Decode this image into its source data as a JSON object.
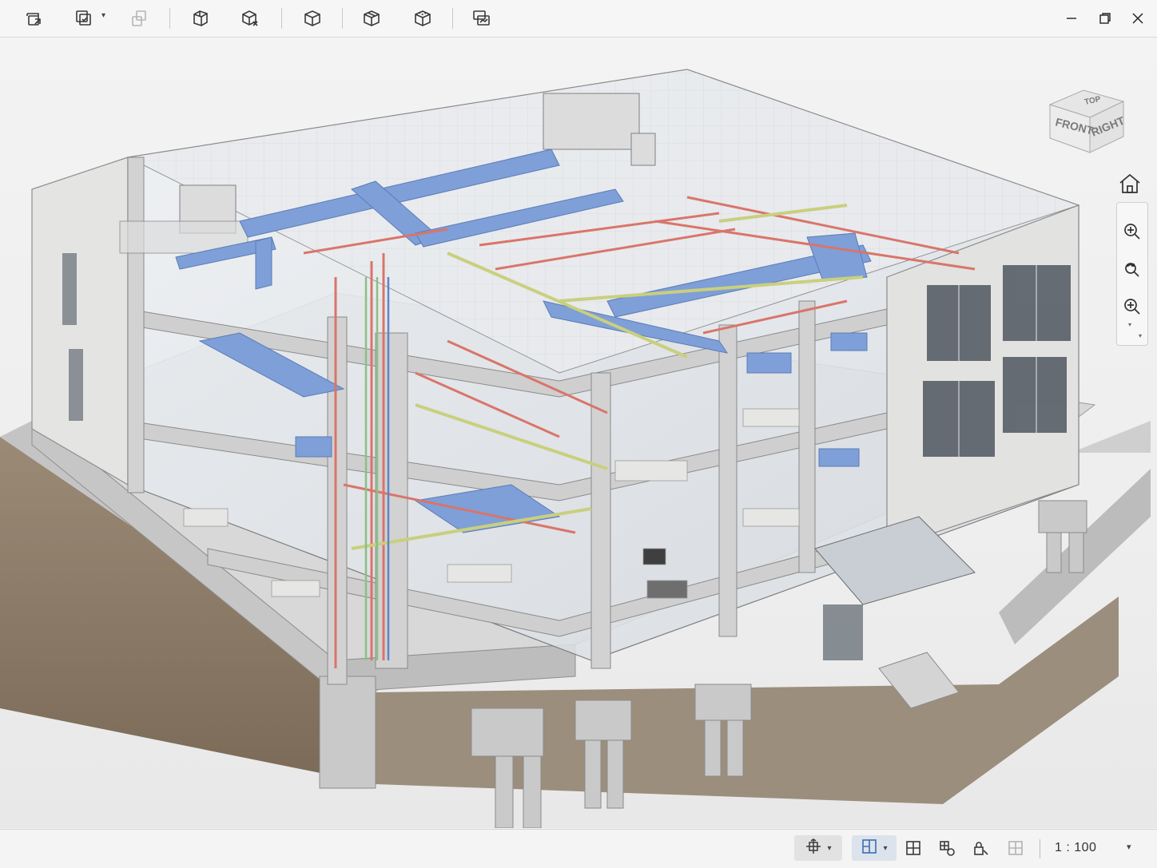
{
  "toolbar": {
    "buttons": [
      {
        "icon": "print-preview-icon"
      },
      {
        "icon": "copy-view-icon",
        "has_dropdown": true
      },
      {
        "icon": "linked-views-icon",
        "disabled": true
      },
      {
        "icon": "section-box-icon"
      },
      {
        "icon": "isolate-cube-icon"
      },
      {
        "icon": "cube-outline-icon"
      },
      {
        "icon": "cube-solid-edges-icon"
      },
      {
        "icon": "cube-hidden-line-icon"
      },
      {
        "icon": "layered-view-icon"
      }
    ]
  },
  "window_controls": [
    "minimize-icon",
    "maximize-icon",
    "close-icon"
  ],
  "viewcube": {
    "top": "TOP",
    "front": "FRONT",
    "right": "RIGHT"
  },
  "navbar": {
    "buttons": [
      "home-icon",
      "zoom-in-icon",
      "orbit-icon",
      "zoom-region-icon"
    ]
  },
  "statusbar": {
    "buttons": [
      {
        "icon": "visual-style-icon",
        "has_dropdown": true
      },
      {
        "icon": "view-layout-icon",
        "has_dropdown": true,
        "active": true
      },
      {
        "icon": "tile-views-icon"
      },
      {
        "icon": "linked-element-icon"
      },
      {
        "icon": "lock-view-icon"
      },
      {
        "icon": "crop-region-icon",
        "disabled": true
      }
    ],
    "scale": "1 : 100"
  },
  "colors": {
    "duct_blue": "#7e9fd8",
    "pipe_red": "#d9756a",
    "tray_yellow": "#d7d99a",
    "concrete": "#c9c9c9",
    "soil": "#8b7a66"
  }
}
